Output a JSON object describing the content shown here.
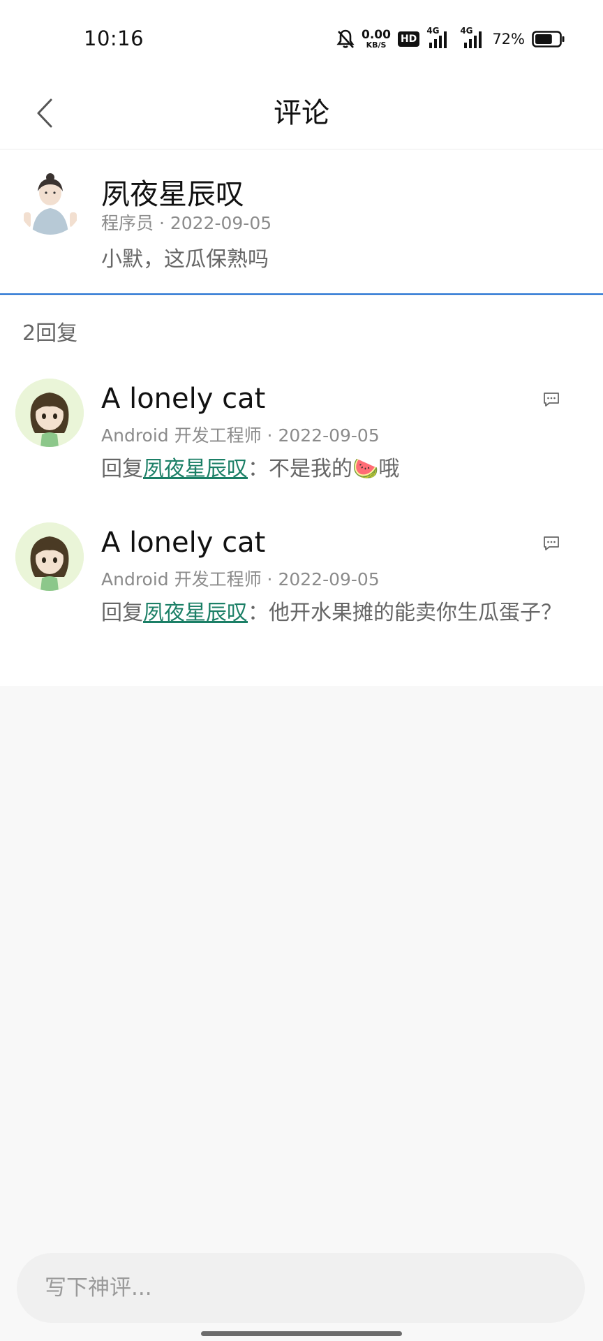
{
  "status_bar": {
    "time": "10:16",
    "net_speed_value": "0.00",
    "net_speed_unit": "KB/S",
    "hd_label": "HD",
    "signal1_label": "4G",
    "signal2_label": "4G",
    "battery_percent": "72%",
    "battery_level": 0.72
  },
  "header": {
    "title": "评论"
  },
  "main_comment": {
    "name": "夙夜星辰叹",
    "meta": "程序员 · 2022-09-05",
    "text": "小默，这瓜保熟吗"
  },
  "replies": {
    "count_label": "2回复",
    "items": [
      {
        "name": "A lonely cat",
        "meta": "Android 开发工程师 · 2022-09-05",
        "prefix": "回复",
        "mention": "夙夜星辰叹",
        "separator": "：",
        "text_before_emoji": "不是我的",
        "emoji": "🍉",
        "text_after_emoji": "哦"
      },
      {
        "name": "A lonely cat",
        "meta": "Android 开发工程师 · 2022-09-05",
        "prefix": "回复",
        "mention": "夙夜星辰叹",
        "separator": "：",
        "text": "他开水果摊的能卖你生瓜蛋子？"
      }
    ]
  },
  "comment_input": {
    "placeholder": "写下神评..."
  },
  "colors": {
    "accent_line": "#1f6fd1",
    "mention_link": "#1b7f66"
  }
}
